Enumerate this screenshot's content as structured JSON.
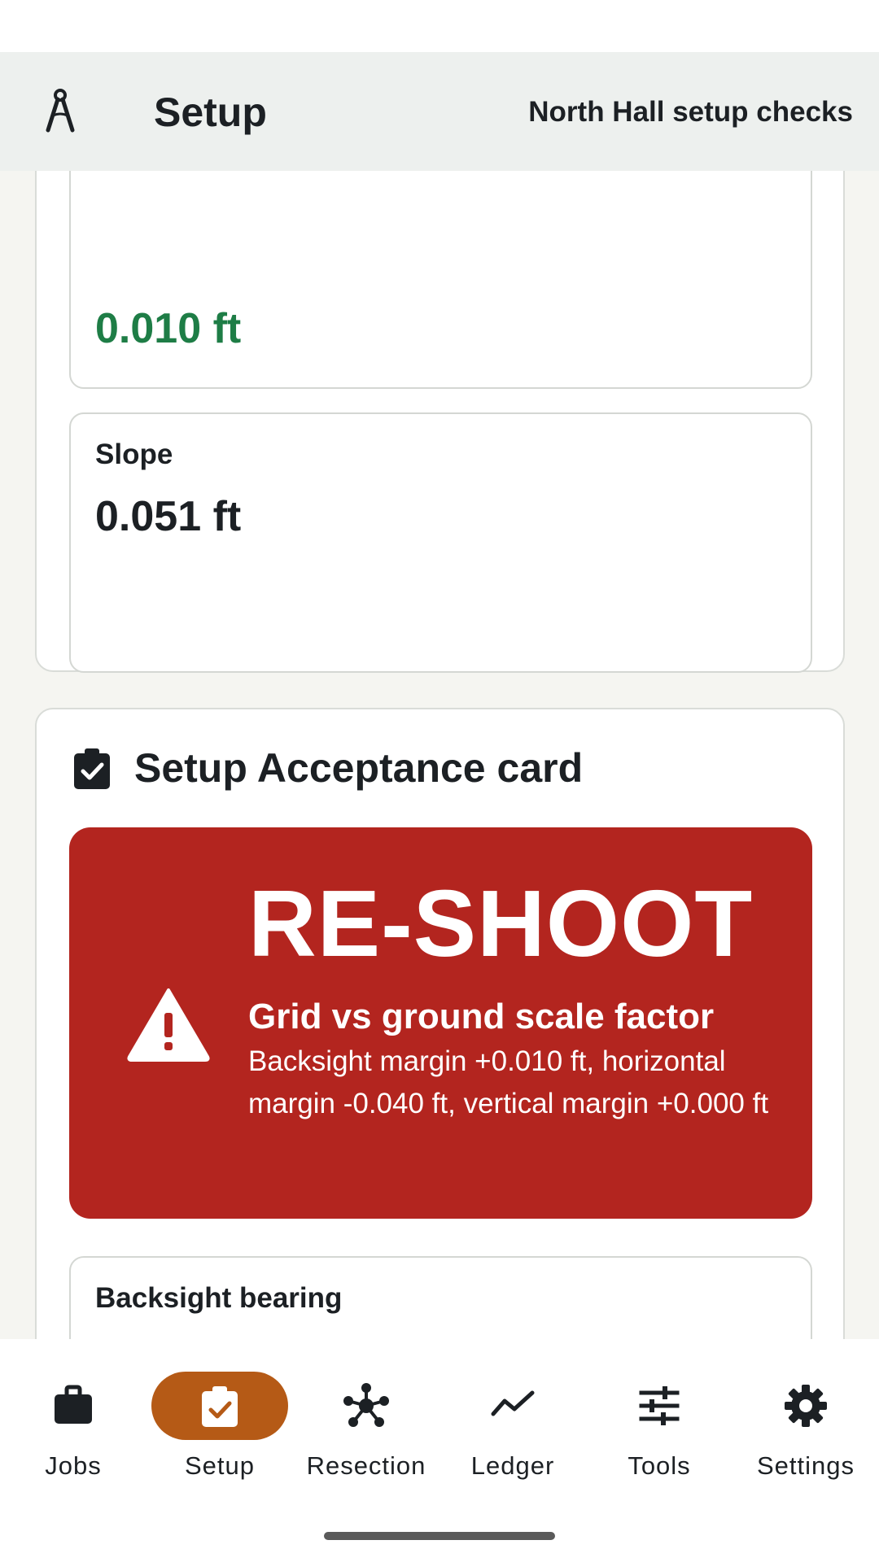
{
  "app_bar": {
    "title": "Setup",
    "subtitle": "North Hall setup checks",
    "logo_icon": "compass-icon"
  },
  "measurements": {
    "first_value": "0.010 ft",
    "slope_label": "Slope",
    "slope_value": "0.051 ft"
  },
  "acceptance": {
    "title": "Setup Acceptance card",
    "title_icon": "clipboard-check-icon",
    "verdict": "RE-SHOOT",
    "verdict_icon": "warning-icon",
    "heading": "Grid vs ground scale factor",
    "detail": "Backsight margin +0.010 ft, horizontal margin -0.040 ft, vertical margin +0.000 ft"
  },
  "backsight": {
    "label": "Backsight bearing"
  },
  "nav": {
    "items": [
      {
        "label": "Jobs",
        "icon": "briefcase-icon"
      },
      {
        "label": "Setup",
        "icon": "clipboard-check-icon",
        "active": true
      },
      {
        "label": "Resection",
        "icon": "network-icon"
      },
      {
        "label": "Ledger",
        "icon": "trend-line-icon"
      },
      {
        "label": "Tools",
        "icon": "sliders-icon"
      },
      {
        "label": "Settings",
        "icon": "gear-icon"
      }
    ]
  },
  "colors": {
    "accent": "#b55a16",
    "danger": "#b3251f",
    "success": "#1e7d46",
    "app_bar": "#edf0ee"
  }
}
